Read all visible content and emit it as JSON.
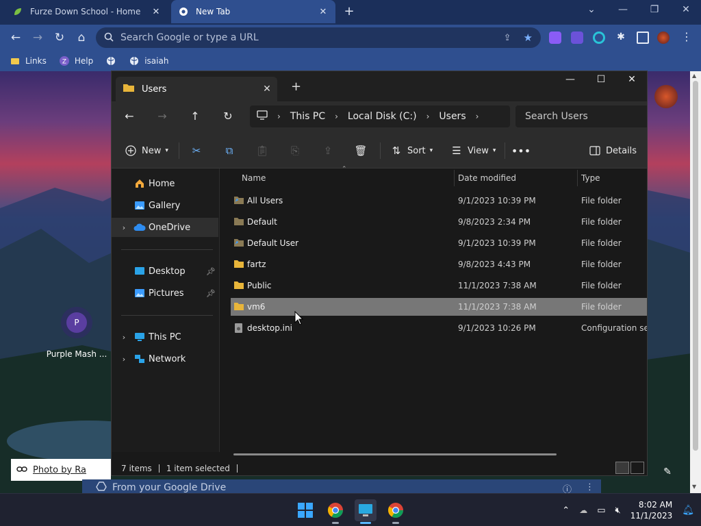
{
  "browser": {
    "tabs": [
      {
        "title": "Furze Down School - Home"
      },
      {
        "title": "New Tab"
      }
    ],
    "omnibox_placeholder": "Search Google or type a URL",
    "bookmarks": [
      "Links",
      "Help",
      "isaiah"
    ]
  },
  "newtab": {
    "shortcut_label": "Purple Mash ...",
    "shortcut_initial": "P",
    "photo_credit": "Photo by Ra",
    "drive_banner": "From your Google Drive"
  },
  "explorer": {
    "tab_title": "Users",
    "breadcrumb": [
      "This PC",
      "Local Disk (C:)",
      "Users"
    ],
    "search_placeholder": "Search Users",
    "commands": {
      "new": "New",
      "sort": "Sort",
      "view": "View",
      "details": "Details"
    },
    "nav": {
      "home": "Home",
      "gallery": "Gallery",
      "onedrive": "OneDrive",
      "desktop": "Desktop",
      "pictures": "Pictures",
      "thispc": "This PC",
      "network": "Network"
    },
    "columns": [
      "Name",
      "Date modified",
      "Type"
    ],
    "rows": [
      {
        "name": "All Users",
        "date": "9/1/2023 10:39 PM",
        "type": "File folder"
      },
      {
        "name": "Default",
        "date": "9/8/2023 2:34 PM",
        "type": "File folder"
      },
      {
        "name": "Default User",
        "date": "9/1/2023 10:39 PM",
        "type": "File folder"
      },
      {
        "name": "fartz",
        "date": "9/8/2023 4:43 PM",
        "type": "File folder"
      },
      {
        "name": "Public",
        "date": "11/1/2023 7:38 AM",
        "type": "File folder"
      },
      {
        "name": "vm6",
        "date": "11/1/2023 7:38 AM",
        "type": "File folder"
      },
      {
        "name": "desktop.ini",
        "date": "9/1/2023 10:26 PM",
        "type": "Configuration setti"
      }
    ],
    "status": {
      "items": "7 items",
      "selected": "1 item selected"
    }
  },
  "taskbar": {
    "time": "8:02 AM",
    "date": "11/1/2023"
  },
  "colors": {
    "folder": "#e8b53a",
    "accent": "#59b7ff",
    "selection": "#777777"
  }
}
